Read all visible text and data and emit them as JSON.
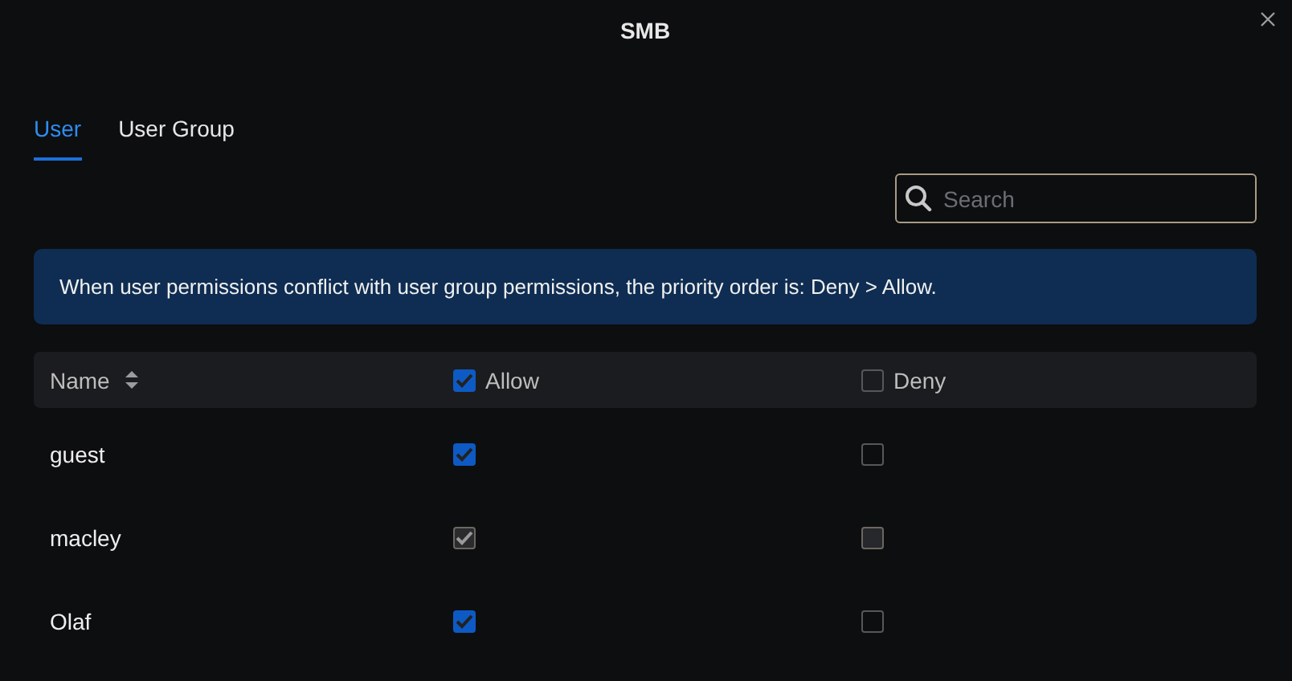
{
  "dialog": {
    "title": "SMB"
  },
  "tabs": [
    {
      "label": "User",
      "selected": true
    },
    {
      "label": "User Group",
      "selected": false
    }
  ],
  "search": {
    "placeholder": "Search"
  },
  "notice": "When user permissions conflict with user group permissions, the priority order is: Deny > Allow.",
  "table": {
    "columns": [
      {
        "label": "Name",
        "kind": "sort"
      },
      {
        "label": "Allow",
        "kind": "check",
        "checked": true
      },
      {
        "label": "Deny",
        "kind": "check",
        "checked": false
      }
    ],
    "rows": [
      {
        "name": "guest",
        "allow": true,
        "deny": false,
        "disabled": false
      },
      {
        "name": "macley",
        "allow": true,
        "deny": false,
        "disabled": true
      },
      {
        "name": "Olaf",
        "allow": true,
        "deny": false,
        "disabled": false
      }
    ]
  }
}
